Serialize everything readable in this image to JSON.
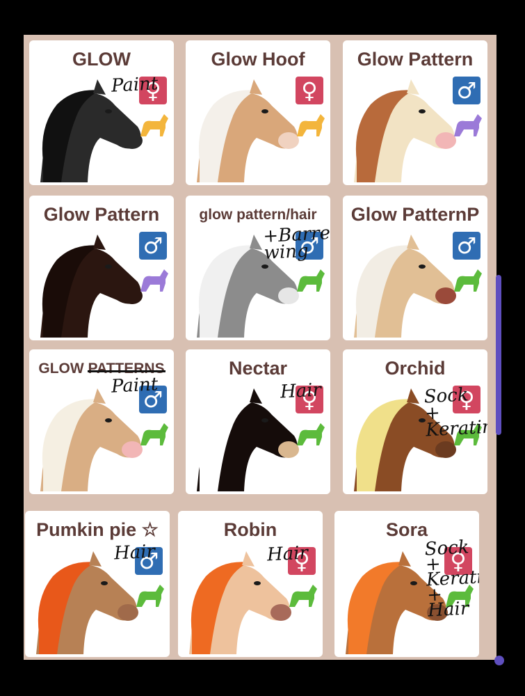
{
  "horses": [
    {
      "name": "GLOW",
      "gender_symbol": "♀",
      "gender_color": "#d24660",
      "age_icon": "foal-icon",
      "age_color": "#f3b53c",
      "note": "Paint",
      "coat": "#2a2a2a",
      "mane": "#111111",
      "muzzle": "#2a2a2a"
    },
    {
      "name": "Glow Hoof",
      "gender_symbol": "♀",
      "gender_color": "#d24660",
      "age_icon": "foal-icon",
      "age_color": "#f3b53c",
      "note": "",
      "coat": "#d9a77a",
      "mane": "#f4f0ea",
      "muzzle": "#f0d2c0"
    },
    {
      "name": "Glow Pattern",
      "gender_symbol": "♂",
      "gender_color": "#2f6db3",
      "age_icon": "resting-horse-icon",
      "age_color": "#9b7ad8",
      "note": "",
      "coat": "#f2e3c4",
      "mane": "#b86a3b",
      "muzzle": "#f2b6b6"
    },
    {
      "name": "Glow Pattern",
      "gender_symbol": "♂",
      "gender_color": "#2f6db3",
      "age_icon": "resting-horse-icon",
      "age_color": "#9b7ad8",
      "note": "",
      "coat": "#2b1610",
      "mane": "#1a0c08",
      "muzzle": "#2b1610"
    },
    {
      "name": "glow pattern/hair",
      "gender_symbol": "♂",
      "gender_color": "#2f6db3",
      "age_icon": "adult-horse-icon",
      "age_color": "#5cbb3c",
      "note": "+Barred\nwing",
      "coat": "#8c8c8c",
      "mane": "#f0f0f0",
      "muzzle": "#e6e6e6"
    },
    {
      "name": "Glow PatternP",
      "gender_symbol": "♂",
      "gender_color": "#2f6db3",
      "age_icon": "adult-horse-icon",
      "age_color": "#5cbb3c",
      "note": "",
      "coat": "#e1bf95",
      "mane": "#f2ede4",
      "muzzle": "#9a4a3a"
    },
    {
      "name": "GLOW PATTERNS",
      "gender_symbol": "♂",
      "gender_color": "#2f6db3",
      "age_icon": "adult-horse-icon",
      "age_color": "#5cbb3c",
      "note": "Paint",
      "coat": "#d9ae84",
      "mane": "#f5efe2",
      "muzzle": "#f2b6b6"
    },
    {
      "name": "Nectar",
      "gender_symbol": "♀",
      "gender_color": "#d24660",
      "age_icon": "adult-horse-icon",
      "age_color": "#5cbb3c",
      "note": "Hair",
      "coat": "#150c0a",
      "mane": "#ffffff",
      "muzzle": "#d9b78f"
    },
    {
      "name": "Orchid",
      "gender_symbol": "♀",
      "gender_color": "#d24660",
      "age_icon": "adult-horse-icon",
      "age_color": "#5cbb3c",
      "note": "Sock\n+\nKeratin",
      "coat": "#8a4c25",
      "mane": "#f0e08a",
      "muzzle": "#6b3b20"
    },
    {
      "name": "Pumkin pie ☆",
      "gender_symbol": "♂",
      "gender_color": "#2f6db3",
      "age_icon": "adult-horse-icon",
      "age_color": "#5cbb3c",
      "note": "Hair",
      "coat": "#b78155",
      "mane": "#e8581a",
      "muzzle": "#a06a4a"
    },
    {
      "name": "Robin",
      "gender_symbol": "♀",
      "gender_color": "#d24660",
      "age_icon": "adult-horse-icon",
      "age_color": "#5cbb3c",
      "note": "Hair",
      "coat": "#eec29d",
      "mane": "#ee6a22",
      "muzzle": "#a86a5a"
    },
    {
      "name": "Sora",
      "gender_symbol": "♀",
      "gender_color": "#d24660",
      "age_icon": "adult-horse-icon",
      "age_color": "#5cbb3c",
      "note": "Sock\n+\nKeratin\n+\nHair",
      "coat": "#b9703b",
      "mane": "#f27a2a",
      "muzzle": "#8a5030"
    }
  ]
}
